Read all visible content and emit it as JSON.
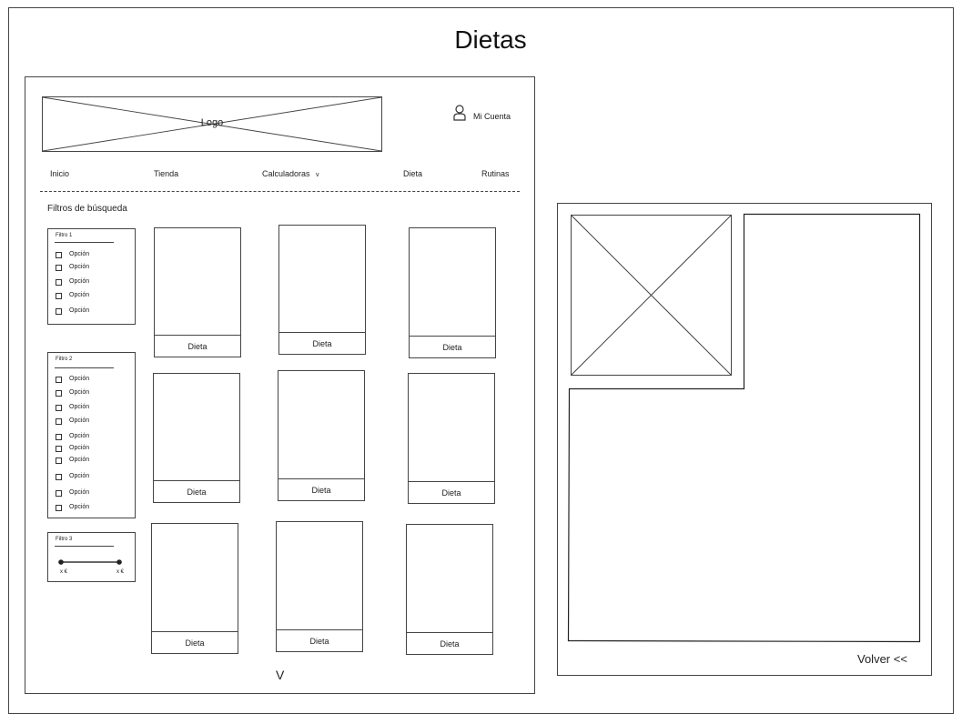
{
  "page": {
    "title": "Dietas"
  },
  "header": {
    "logo": "Logo",
    "account_label": "Mi Cuenta",
    "account_icon": "user-icon"
  },
  "nav": {
    "items": [
      "Inicio",
      "Tienda",
      "Calculadoras",
      "Dieta",
      "Rutinas"
    ],
    "dropdown_marker": "v"
  },
  "filters": {
    "title": "Filtros de búsqueda",
    "groups": [
      {
        "title": "Filtro 1",
        "options": [
          "Opción",
          "Opción",
          "Opción",
          "Opción",
          "Opción"
        ]
      },
      {
        "title": "Filtro 2",
        "options": [
          "Opción",
          "Opción",
          "Opción",
          "Opción",
          "Opción",
          "Opción",
          "Opción",
          "Opción",
          "Opción",
          "Opción"
        ]
      },
      {
        "title": "Filtro 3",
        "range_min": "x €",
        "range_max": "x €"
      }
    ]
  },
  "cards": [
    "Dieta",
    "Dieta",
    "Dieta",
    "Dieta",
    "Dieta",
    "Dieta",
    "Dieta",
    "Dieta",
    "Dieta"
  ],
  "pagination": {
    "more": "V"
  },
  "detail": {
    "back_label": "Volver <<"
  }
}
